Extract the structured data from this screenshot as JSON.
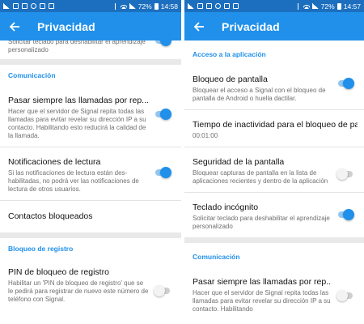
{
  "colors": {
    "status_bar": "#1c6fbf",
    "app_bar": "#2090ea",
    "accent": "#2090ea"
  },
  "left": {
    "status": {
      "battery": "72%",
      "time": "14:58"
    },
    "title": "Privacidad",
    "top_partial": {
      "summary": "Solicitar teclado para deshabilitar el aprendizaje personalizado",
      "toggle_on": true
    },
    "section_comunicacion": "Comunicación",
    "calls": {
      "title": "Pasar siempre las llamadas por rep...",
      "summary": "Hacer que el servidor de Signal repita todas las llamadas para evitar revelar su dirección IP a su contacto. Habilitando esto reducirá la calidad de la llamada.",
      "toggle_on": true
    },
    "read_receipts": {
      "title": "Notificaciones de lectura",
      "summary": "Si las notificaciones de lectura están des-habilitadas, no podrá ver las notificaciones de lectura de otros usuarios.",
      "toggle_on": true
    },
    "blocked": {
      "title": "Contactos bloqueados"
    },
    "section_registro": "Bloqueo de registro",
    "pin": {
      "title": "PIN de bloqueo de registro",
      "summary": "Habilitar un 'PIN de bloqueo de registro' que se le pedirá para registrar de nuevo este número de teléfono con Signal.",
      "toggle_on": false
    }
  },
  "right": {
    "status": {
      "battery": "72%",
      "time": "14:57"
    },
    "title": "Privacidad",
    "section_acceso": "Acceso a la aplicación",
    "screen_lock": {
      "title": "Bloqueo de pantalla",
      "summary": "Bloquear el acceso a Signal con el bloqueo de pantalla de Android o huella dactilar.",
      "toggle_on": true
    },
    "inactivity": {
      "title": "Tiempo de inactividad para el bloqueo de pa...",
      "summary": "00:01:00"
    },
    "screen_security": {
      "title": "Seguridad de la pantalla",
      "summary": "Bloquear capturas de pantalla en la lista de aplicaciones recientes y dentro de la aplicación",
      "toggle_on": false
    },
    "incognito_keyboard": {
      "title": "Teclado incógnito",
      "summary": "Solicitar teclado para deshabilitar el aprendizaje personalizado",
      "toggle_on": true
    },
    "section_comunicacion": "Comunicación",
    "calls": {
      "title": "Pasar siempre las llamadas por rep...",
      "summary": "Hacer que el servidor de Signal repita todas las llamadas para evitar revelar su dirección IP a su contacto. Habilitando",
      "toggle_on": false
    }
  }
}
